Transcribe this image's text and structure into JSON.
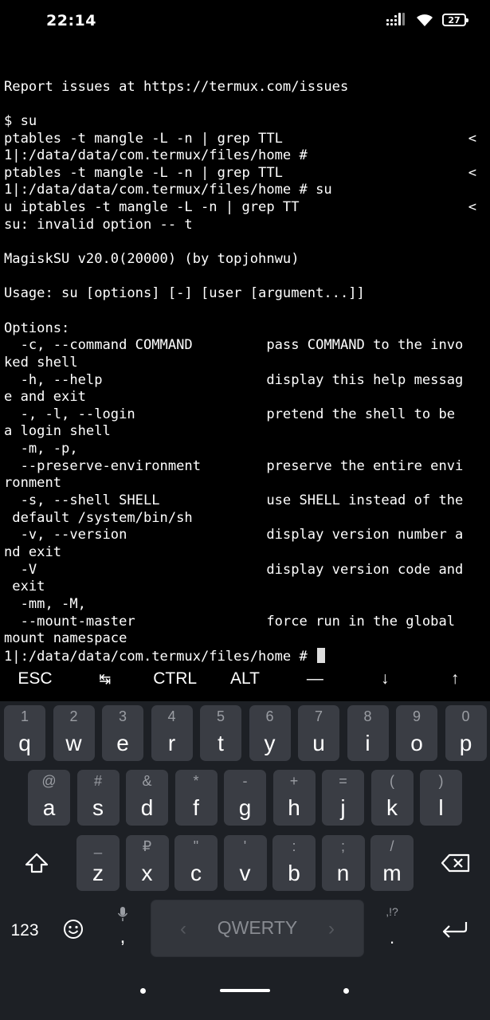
{
  "status_bar": {
    "time": "22:14",
    "battery": "27"
  },
  "terminal": {
    "lines": [
      "",
      "Report issues at https://termux.com/issues",
      "",
      "$ su",
      "ptables -t mangle -L -n | grep TTL",
      "1|:/data/data/com.termux/files/home #",
      "ptables -t mangle -L -n | grep TTL",
      "1|:/data/data/com.termux/files/home # su",
      "u iptables -t mangle -L -n | grep TT",
      "su: invalid option -- t",
      "",
      "MagiskSU v20.0(20000) (by topjohnwu)",
      "",
      "Usage: su [options] [-] [user [argument...]]",
      "",
      "Options:",
      "  -c, --command COMMAND         pass COMMAND to the invo",
      "ked shell",
      "  -h, --help                    display this help messag",
      "e and exit",
      "  -, -l, --login                pretend the shell to be",
      "a login shell",
      "  -m, -p,",
      "  --preserve-environment        preserve the entire envi",
      "ronment",
      "  -s, --shell SHELL             use SHELL instead of the",
      " default /system/bin/sh",
      "  -v, --version                 display version number a",
      "nd exit",
      "  -V                            display version code and",
      " exit",
      "  -mm, -M,",
      "  --mount-master                force run in the global",
      "mount namespace",
      "1|:/data/data/com.termux/files/home # "
    ],
    "truncation_marker": "<"
  },
  "extra_keys": [
    {
      "label": "ESC",
      "name": "esc-key"
    },
    {
      "label": "↹",
      "name": "tab-key"
    },
    {
      "label": "CTRL",
      "name": "ctrl-key"
    },
    {
      "label": "ALT",
      "name": "alt-key"
    },
    {
      "label": "—",
      "name": "dash-key"
    },
    {
      "label": "↓",
      "name": "arrow-down-key"
    },
    {
      "label": "↑",
      "name": "arrow-up-key"
    }
  ],
  "keyboard": {
    "row1": [
      {
        "hint": "1",
        "key": "q"
      },
      {
        "hint": "2",
        "key": "w"
      },
      {
        "hint": "3",
        "key": "e"
      },
      {
        "hint": "4",
        "key": "r"
      },
      {
        "hint": "5",
        "key": "t"
      },
      {
        "hint": "6",
        "key": "y"
      },
      {
        "hint": "7",
        "key": "u"
      },
      {
        "hint": "8",
        "key": "i"
      },
      {
        "hint": "9",
        "key": "o"
      },
      {
        "hint": "0",
        "key": "p"
      }
    ],
    "row2": [
      {
        "hint": "@",
        "key": "a"
      },
      {
        "hint": "#",
        "key": "s"
      },
      {
        "hint": "&",
        "key": "d"
      },
      {
        "hint": "*",
        "key": "f"
      },
      {
        "hint": "-",
        "key": "g"
      },
      {
        "hint": "+",
        "key": "h"
      },
      {
        "hint": "=",
        "key": "j"
      },
      {
        "hint": "(",
        "key": "k"
      },
      {
        "hint": ")",
        "key": "l"
      }
    ],
    "row3": [
      {
        "hint": "_",
        "key": "z"
      },
      {
        "hint": "₽",
        "key": "x"
      },
      {
        "hint": "\"",
        "key": "c"
      },
      {
        "hint": "'",
        "key": "v"
      },
      {
        "hint": ":",
        "key": "b"
      },
      {
        "hint": ";",
        "key": "n"
      },
      {
        "hint": "/",
        "key": "m"
      }
    ],
    "numbers_label": "123",
    "comma_label": ",",
    "space_label": "QWERTY",
    "period_hint": ",!?",
    "period_label": "."
  },
  "icons": {
    "shift": "shift-icon",
    "backspace": "backspace-icon",
    "emoji": "emoji-icon",
    "mic": "microphone-icon",
    "enter": "enter-icon"
  }
}
